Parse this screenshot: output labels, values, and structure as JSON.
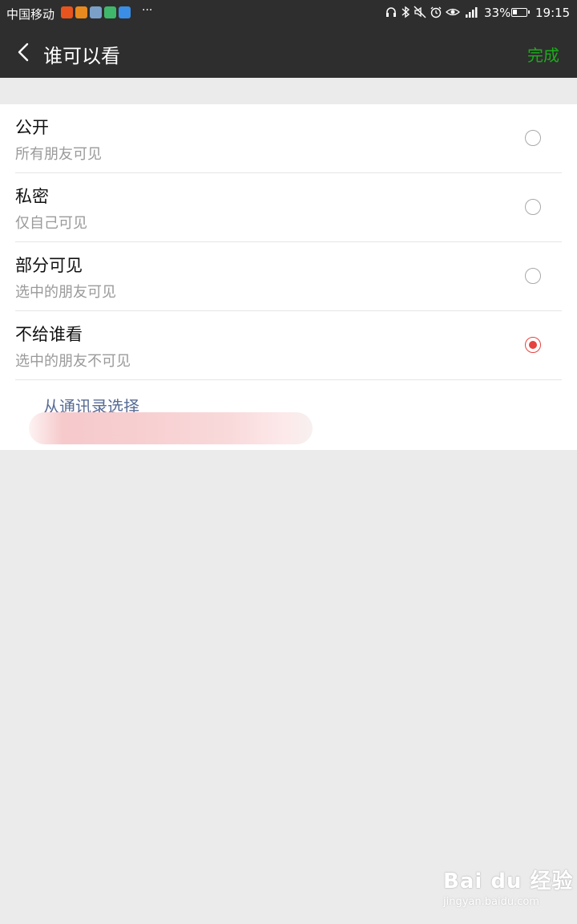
{
  "status_bar": {
    "carrier": "中国移动",
    "more": "···",
    "battery": "33%",
    "time": "19:15",
    "app_icons": [
      {
        "name": "weibo-app-icon",
        "color": "#e8541e"
      },
      {
        "name": "weibo-eye-app-icon",
        "color": "#e88a1e"
      },
      {
        "name": "browser-app-icon",
        "color": "#7aa0c8"
      },
      {
        "name": "play-app-icon",
        "color": "#3fb86b"
      },
      {
        "name": "send-app-icon",
        "color": "#3a8ee6"
      }
    ],
    "system_icons": [
      "headphones-icon",
      "bluetooth-icon",
      "mute-icon",
      "alarm-icon",
      "eye-icon",
      "signal-icon"
    ]
  },
  "nav": {
    "title": "谁可以看",
    "done_label": "完成"
  },
  "options": [
    {
      "label": "公开",
      "desc": "所有朋友可见",
      "checked": false
    },
    {
      "label": "私密",
      "desc": "仅自己可见",
      "checked": false
    },
    {
      "label": "部分可见",
      "desc": "选中的朋友可见",
      "checked": false
    },
    {
      "label": "不给谁看",
      "desc": "选中的朋友不可见",
      "checked": true
    }
  ],
  "contacts_link": "从通讯录选择",
  "watermark": {
    "logo": "Bai du 经验",
    "url": "jingyan.baidu.com"
  },
  "colors": {
    "nav_bg": "#2e2e2e",
    "accent_green": "#1aad19",
    "radio_selected": "#e64340",
    "link_blue": "#576b95"
  }
}
